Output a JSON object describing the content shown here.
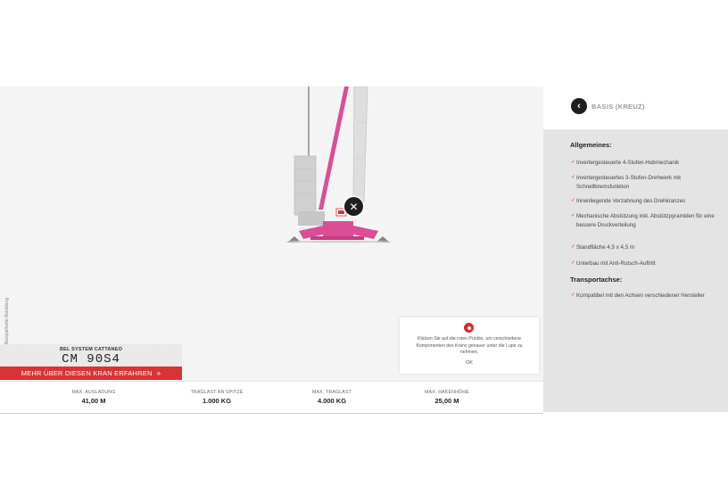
{
  "stage": {
    "side_caption": "Beispielhafte Abbildung",
    "hotspot_label": "✕",
    "tooltip": {
      "message": "Klicken Sie auf die roten Punkte, um verschiedene Komponenten des Krans genauer unter die Lupe zu nehmen.",
      "ok": "OK"
    }
  },
  "brand": {
    "system": "BEL SYSTEM CATTANEO",
    "model": "CM 90S4"
  },
  "more_button": {
    "label": "MEHR ÜBER DIESEN KRAN ERFAHREN",
    "arrow": "»"
  },
  "specs": [
    {
      "label": "MAX. AUSLADUNG",
      "value": "41,00 M"
    },
    {
      "label": "TRAGLAST AN SPITZE",
      "value": "1.000 KG"
    },
    {
      "label": "MAX. TRAGLAST",
      "value": "4.000 KG"
    },
    {
      "label": "MAX. HAKENHÖHE",
      "value": "25,00 M"
    }
  ],
  "panel": {
    "back_icon": "‹",
    "title": "BASIS (KREUZ)",
    "sections": [
      {
        "heading": "Allgemeines:",
        "items": [
          "Invertergesteuerte 4-Stufen-Hubmechanik",
          "Invertergesteuertes 3-Stufen-Drehwerk mit Schnellbremsfunktion",
          "Innenliegende Verzahnung des Drehkranzes",
          "Mechanische Abstützung inkl. Abstützpyramiden für eine bessere Druckverteilung",
          "Standfläche 4,5 x 4,5 m",
          "Unterbau mit Anti-Rutsch-Auftritt"
        ]
      },
      {
        "heading": "Transportachse:",
        "items": [
          "Kompatibel mit den Achsen verschiedener Hersteller"
        ]
      }
    ]
  },
  "colors": {
    "accent": "#d93335",
    "crane_pink": "#d94f97",
    "panel_bg": "#e4e4e4",
    "stage_bg": "#f4f4f4"
  }
}
